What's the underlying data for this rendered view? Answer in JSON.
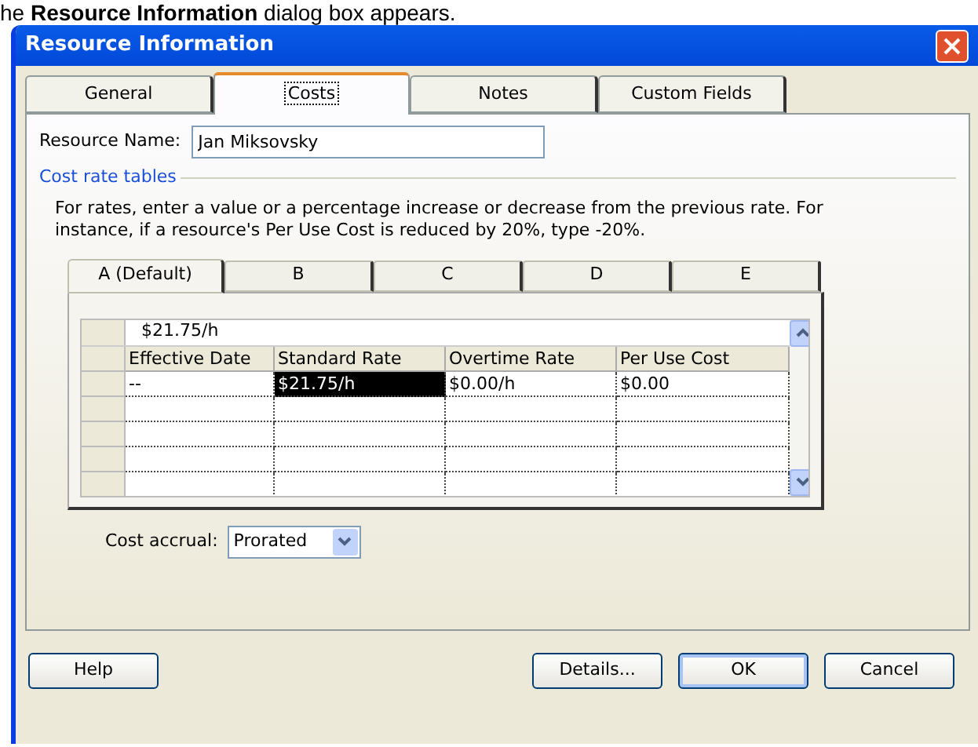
{
  "caption": "he **Resource Information** dialog box appears.",
  "window": {
    "title": "Resource Information"
  },
  "tabs": [
    {
      "label": "General",
      "selected": false
    },
    {
      "label": "Costs",
      "selected": true
    },
    {
      "label": "Notes",
      "selected": false
    },
    {
      "label": "Custom Fields",
      "selected": false
    }
  ],
  "resource_name": {
    "label": "Resource Name:",
    "value": "Jan Miksovsky"
  },
  "cost_rate_tables": {
    "heading": "Cost rate tables",
    "description": "For rates, enter a value or a percentage increase or decrease from the previous rate. For instance, if a resource's Per Use Cost is reduced by 20%, type -20%.",
    "tabs": [
      {
        "label": "A (Default)",
        "selected": true
      },
      {
        "label": "B",
        "selected": false
      },
      {
        "label": "C",
        "selected": false
      },
      {
        "label": "D",
        "selected": false
      },
      {
        "label": "E",
        "selected": false
      }
    ],
    "edit_value": "$21.75/h",
    "columns": [
      "Effective Date",
      "Standard Rate",
      "Overtime Rate",
      "Per Use Cost"
    ],
    "rows": [
      {
        "cells": [
          {
            "text": "--",
            "selected": false
          },
          {
            "text": "$21.75/h",
            "selected": true
          },
          {
            "text": "$0.00/h",
            "selected": false
          },
          {
            "text": "$0.00",
            "selected": false
          }
        ]
      }
    ]
  },
  "cost_accrual": {
    "label": "Cost accrual:",
    "value": "Prorated"
  },
  "buttons": [
    {
      "label": "Help",
      "kind": "left"
    },
    {
      "label": "Details...",
      "kind": "right"
    },
    {
      "label": "OK",
      "kind": "default"
    },
    {
      "label": "Cancel",
      "kind": "right"
    }
  ]
}
